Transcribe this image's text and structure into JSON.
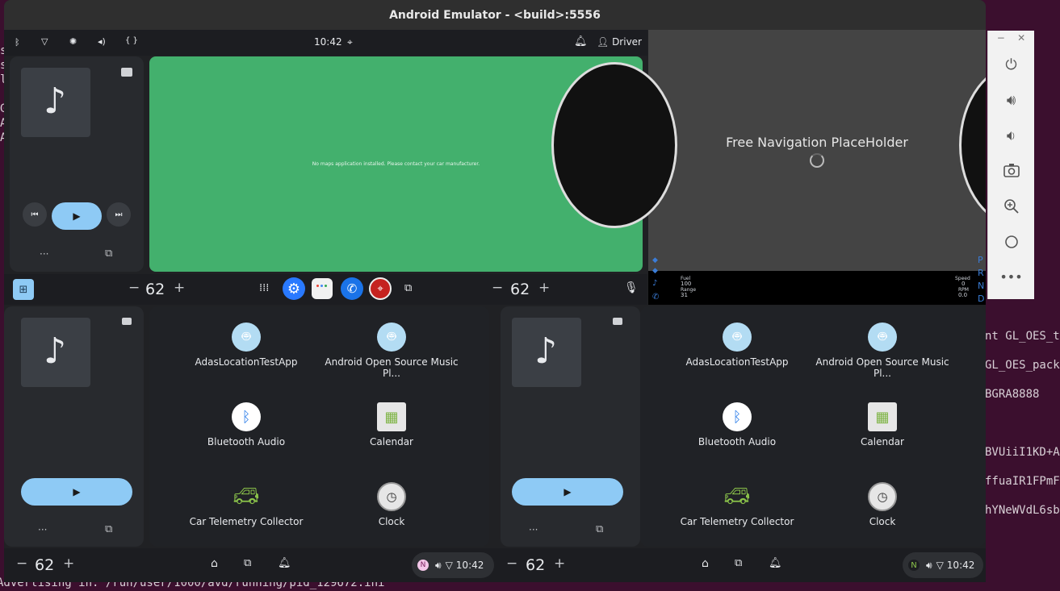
{
  "window": {
    "title": "Android Emulator - <build>:5556"
  },
  "terminal": {
    "left_lines": [
      "s",
      "s",
      "l",
      "",
      "G",
      "A",
      "A",
      "",
      "",
      "",
      "",
      "",
      "",
      "",
      "",
      "",
      "",
      "",
      "",
      "",
      "",
      "",
      "",
      "",
      "",
      "",
      "",
      "",
      "",
      "",
      "",
      "",
      "",
      ""
    ],
    "right_lines": [
      "nt GL_OES_t",
      "GL_OES_pack",
      "BGRA8888",
      "",
      "BVUiiI1KD+A",
      "ffuaIR1FPmF",
      "hYNeWVdL6sb"
    ],
    "bottom_line": "Advertising in: /run/user/1000/avd/running/pid_129672.ini"
  },
  "status_bar": {
    "time": "10:42",
    "user": "Driver"
  },
  "green_screen": {
    "message": "No maps application installed. Please contact your car manufacturer."
  },
  "mid_bar": {
    "left_temp": "62",
    "right_temp": "62",
    "minus": "−",
    "plus": "+"
  },
  "nav_display": {
    "title": "Free Navigation PlaceHolder"
  },
  "cluster": {
    "labels_left": [
      "Fuel",
      "Range",
      "",
      ""
    ],
    "values_left": [
      "100",
      "31"
    ],
    "labels_right": [
      "Speed",
      "RPM"
    ],
    "values_right": [
      "0",
      "0.0"
    ],
    "gear_letters": [
      "P",
      "R",
      "N",
      "D"
    ]
  },
  "apps": [
    {
      "name": "AdasLocationTestApp",
      "icon": "android-icon"
    },
    {
      "name": "Android Open Source Music Pl...",
      "icon": "android-icon"
    },
    {
      "name": "Bluetooth Audio",
      "icon": "bluetooth-icon"
    },
    {
      "name": "Calendar",
      "icon": "calendar-icon"
    },
    {
      "name": "Car Telemetry Collector",
      "icon": "car-icon"
    },
    {
      "name": "Clock",
      "icon": "clock-icon"
    }
  ],
  "bottom_bar": {
    "left_temp": "62",
    "right_temp": "62",
    "time": "10:42",
    "time2": "10:42",
    "n_badge": "N"
  },
  "colors": {
    "accent_blue": "#8ecaf5",
    "green_screen": "#43b06d",
    "panel": "#282a2e"
  }
}
